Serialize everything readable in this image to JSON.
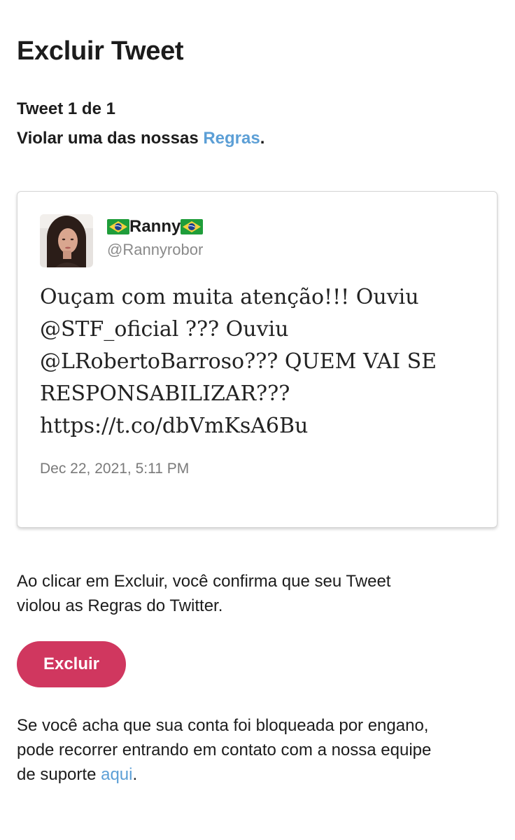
{
  "page": {
    "title": "Excluir Tweet",
    "tweet_count": "Tweet 1 de 1",
    "reason_prefix": "Violar uma das nossas ",
    "reason_link": "Regras",
    "reason_suffix": "."
  },
  "tweet": {
    "author_name": "Ranny",
    "author_handle": "@Rannyrobor",
    "text_lines": [
      "Ouçam com muita atenção!!! Ouviu",
      "@STF_oficial ??? Ouviu",
      "@LRobertoBarroso??? QUEM VAI SE",
      "RESPONSABILIZAR???",
      "https://t.co/dbVmKsA6Bu"
    ],
    "date": "Dec 22, 2021, 5:11 PM"
  },
  "confirm": {
    "line1": "Ao clicar em Excluir, você confirma que seu Tweet",
    "line2": "violou as Regras do Twitter."
  },
  "actions": {
    "delete_label": "Excluir"
  },
  "support": {
    "line1": "Se você acha que sua conta foi bloqueada por engano,",
    "line2": "pode recorrer entrando em contato com a nossa equipe",
    "line3_prefix": "de suporte ",
    "line3_link": "aqui",
    "line3_suffix": "."
  },
  "colors": {
    "accent_link": "#5c9fd6",
    "delete_button": "#d0375f",
    "text": "#1c1c1c",
    "muted": "#8a8a8a"
  },
  "icons": {
    "flag": "brazil-flag-icon",
    "avatar": "profile-avatar"
  }
}
